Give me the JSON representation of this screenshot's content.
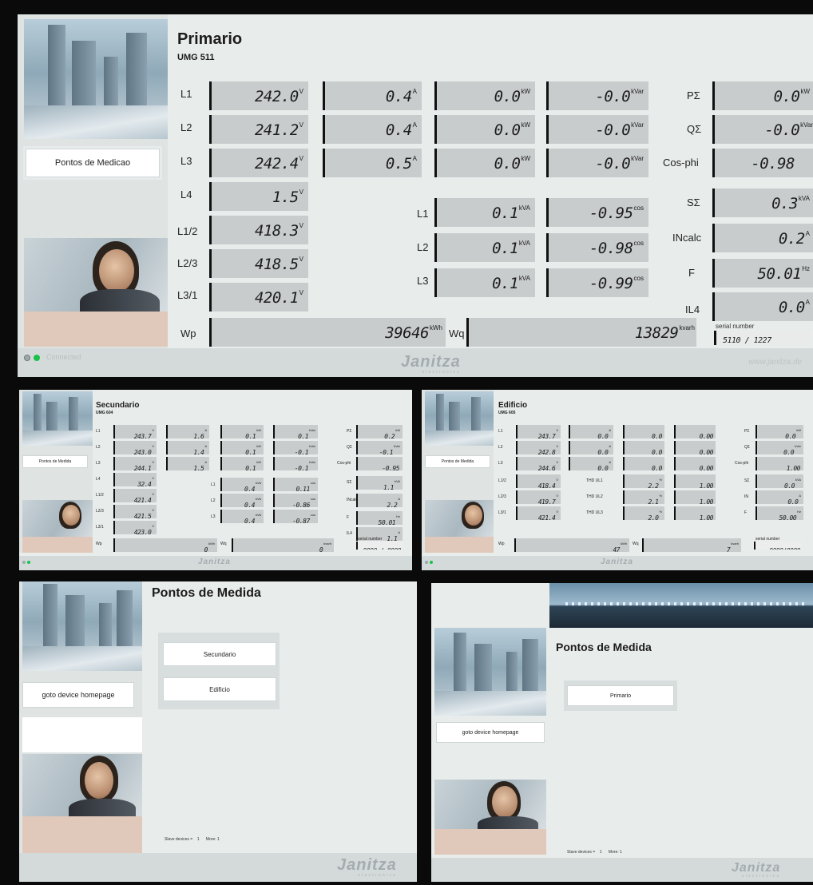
{
  "primario": {
    "title": "Primario",
    "device": "UMG 511",
    "side_button": "Pontos de Medicao",
    "connection": "Connected",
    "logo": "Janitza",
    "logo_sub": "electronics",
    "website": "www.janitza.de",
    "row_labels": [
      "L1",
      "L2",
      "L3",
      "L4",
      "L1/2",
      "L2/3",
      "L3/1"
    ],
    "voltage": [
      {
        "v": "242.0",
        "u": "V"
      },
      {
        "v": "241.2",
        "u": "V"
      },
      {
        "v": "242.4",
        "u": "V"
      },
      {
        "v": "1.5",
        "u": "V"
      },
      {
        "v": "418.3",
        "u": "V"
      },
      {
        "v": "418.5",
        "u": "V"
      },
      {
        "v": "420.1",
        "u": "V"
      }
    ],
    "current": [
      {
        "v": "0.4",
        "u": "A"
      },
      {
        "v": "0.4",
        "u": "A"
      },
      {
        "v": "0.5",
        "u": "A"
      }
    ],
    "power": [
      {
        "v": "0.0",
        "u": "kW"
      },
      {
        "v": "0.0",
        "u": "kW"
      },
      {
        "v": "0.0",
        "u": "kW"
      }
    ],
    "reactive": [
      {
        "v": "-0.0",
        "u": "kVar"
      },
      {
        "v": "-0.0",
        "u": "kVar"
      },
      {
        "v": "-0.0",
        "u": "kVar"
      }
    ],
    "apparent_labels": [
      "L1",
      "L2",
      "L3"
    ],
    "apparent": [
      {
        "v": "0.1",
        "u": "kVA"
      },
      {
        "v": "0.1",
        "u": "kVA"
      },
      {
        "v": "0.1",
        "u": "kVA"
      }
    ],
    "cos": [
      {
        "v": "-0.95",
        "u": "cos"
      },
      {
        "v": "-0.98",
        "u": "cos"
      },
      {
        "v": "-0.99",
        "u": "cos"
      }
    ],
    "right_labels": [
      "PΣ",
      "QΣ",
      "Cos-phi",
      "SΣ",
      "INcalc",
      "F",
      "IL4"
    ],
    "right_values": [
      {
        "v": "0.0",
        "u": "kW"
      },
      {
        "v": "-0.0",
        "u": "kVar"
      },
      {
        "v": "-0.98",
        "u": ""
      },
      {
        "v": "0.3",
        "u": "kVA"
      },
      {
        "v": "0.2",
        "u": "A"
      },
      {
        "v": "50.01",
        "u": "Hz"
      },
      {
        "v": "0.0",
        "u": "A"
      }
    ],
    "wp_label": "Wp",
    "wp": {
      "v": "39646",
      "u": "kWh"
    },
    "wq_label": "Wq",
    "wq": {
      "v": "13829",
      "u": "kvarh"
    },
    "serial_label": "serial number",
    "serial": "5110 / 1227"
  },
  "secundario": {
    "title": "Secundario",
    "device": "UMG 604",
    "side_button": "Pontos de Medida",
    "row_labels": [
      "L1",
      "L2",
      "L3",
      "L4",
      "L1/2",
      "L2/3",
      "L3/1"
    ],
    "voltage": [
      "243.7",
      "243.0",
      "244.1",
      "32.4",
      "421.4",
      "421.5",
      "423.0"
    ],
    "voltage_unit": "V",
    "current": [
      "1.6",
      "1.4",
      "1.5"
    ],
    "current_unit": "A",
    "power": [
      "0.1",
      "0.1",
      "0.1"
    ],
    "power_unit": "kW",
    "reactive": [
      "0.1",
      "-0.1",
      "-0.1"
    ],
    "reactive_unit": "kVar",
    "apparent_labels": [
      "L1",
      "L2",
      "L3"
    ],
    "apparent": [
      "0.4",
      "0.4",
      "0.4"
    ],
    "apparent_unit": "kVA",
    "cos": [
      "0.11",
      "-0.86",
      "-0.87"
    ],
    "cos_unit": "cos",
    "right_labels": [
      "PΣ",
      "QΣ",
      "Cos-phi",
      "SΣ",
      "INcalc",
      "F",
      "IL4"
    ],
    "right_values": [
      "0.2",
      "-0.1",
      "-0.95",
      "1.1",
      "2.2",
      "50.01",
      "1.1"
    ],
    "right_units": [
      "kW",
      "kVar",
      "",
      "kVA",
      "A",
      "Hz",
      "A"
    ],
    "wp_label": "Wp",
    "wp": "0",
    "wp_unit": "kWh",
    "wq_label": "Wq",
    "wq": "0",
    "wq_unit": "kvarh",
    "serial_label": "serial number",
    "serial": "0000 / 0000",
    "logo": "Janitza"
  },
  "edificio": {
    "title": "Edificio",
    "device": "UMG 605",
    "side_button": "Pontos de Medida",
    "row_labels": [
      "L1",
      "L2",
      "L3",
      "L1/2",
      "L2/3",
      "L3/1"
    ],
    "voltage": [
      "243.7",
      "242.8",
      "244.6",
      "418.4",
      "419.7",
      "421.4"
    ],
    "voltage_unit": "V",
    "current": [
      "0.0",
      "0.0",
      "0.0"
    ],
    "current_unit": "A",
    "power": [
      "0.0",
      "0.0",
      "0.0"
    ],
    "pf": [
      "0.00",
      "0.00",
      "0.00"
    ],
    "thd_labels": [
      "THD UL1",
      "THD UL2",
      "THD UL3"
    ],
    "thd": [
      "2.2",
      "2.1",
      "2.0"
    ],
    "thd_unit": "%",
    "thd_cos": [
      "1.00",
      "1.00",
      "1.00"
    ],
    "right_labels": [
      "PΣ",
      "QΣ",
      "Cos-phi",
      "SΣ",
      "IN",
      "F"
    ],
    "right_values": [
      "0.0",
      "0.0",
      "1.00",
      "0.0",
      "0.0",
      "50.00"
    ],
    "right_units": [
      "kW",
      "kVar",
      "",
      "kVA",
      "A",
      "Hz"
    ],
    "wp_label": "Wp",
    "wp": "47",
    "wp_unit": "kWh",
    "wq_label": "Wq",
    "wq": "7",
    "wq_unit": "kvarh",
    "serial_label": "serial number",
    "serial": "0000/0000",
    "logo": "Janitza"
  },
  "medida1": {
    "title": "Pontos de Medida",
    "buttons": [
      "Secundario",
      "Edificio"
    ],
    "side_button": "goto device homepage",
    "status_label": "Slave devices =",
    "status_count": "1",
    "status_more": "More: 1",
    "logo": "Janitza",
    "logo_sub": "electronics"
  },
  "medida2": {
    "title": "Pontos de Medida",
    "buttons": [
      "Primario"
    ],
    "side_button": "goto device homepage",
    "status_label": "Slave devices =",
    "status_count": "1",
    "status_more": "More: 1",
    "logo": "Janitza",
    "logo_sub": "electronics"
  }
}
